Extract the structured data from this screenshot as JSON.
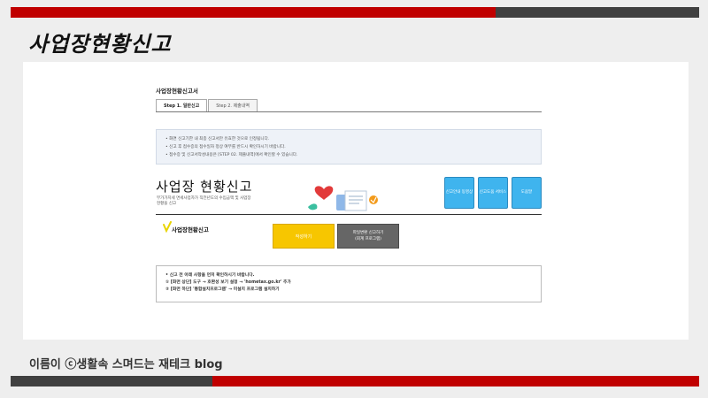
{
  "slide": {
    "title": "사업장현황신고",
    "footer": "이름이  ⓒ생활속 스며드는 재테크 blog"
  },
  "form": {
    "title": "사업장현황신고서",
    "tabs": [
      {
        "label": "Step 1. 일반신고",
        "active": true
      },
      {
        "label": "Step 2. 제출내역",
        "active": false
      }
    ],
    "notice": [
      "• 화면 신고기한 내 최종 신고서만 유효한 것으로 인정됩니다.",
      "• 신고 후 접수증의 접수일자 정상 여부를 반드시 확인하시기 바랍니다.",
      "• 접수증 및 신고서작성내용은 [STEP 02. 제출내역]에서 확인할 수 있습니다."
    ]
  },
  "hero": {
    "title": "사업장 현황신고",
    "subtitle": "부가가치세 면세사업자가 직전년도의 수입금액 및 사업장현황을 신고"
  },
  "quick_buttons": [
    {
      "label": "신고안내 동영상"
    },
    {
      "label": "신고도움 서비스"
    },
    {
      "label": "도움말"
    }
  ],
  "section": {
    "label": "사업장현황신고",
    "write_button": "작성하기",
    "program_button_line1": "파일변환 신고하기",
    "program_button_line2": "(회계 프로그램)"
  },
  "guide": [
    "• 신고 전 아래 사항을 먼저 확인하시기 바랍니다.",
    "① [화면 상단] 도구 → 호환성 보기 설정 → 'hometax.go.kr' 추가",
    "② [화면 하단] '통합설치프로그램' → 미설치 프로그램 설치하기"
  ],
  "colors": {
    "brand_red": "#c00000",
    "dark_grey": "#404040",
    "quick_blue": "#3fb4ee",
    "write_yellow": "#f7c600"
  }
}
